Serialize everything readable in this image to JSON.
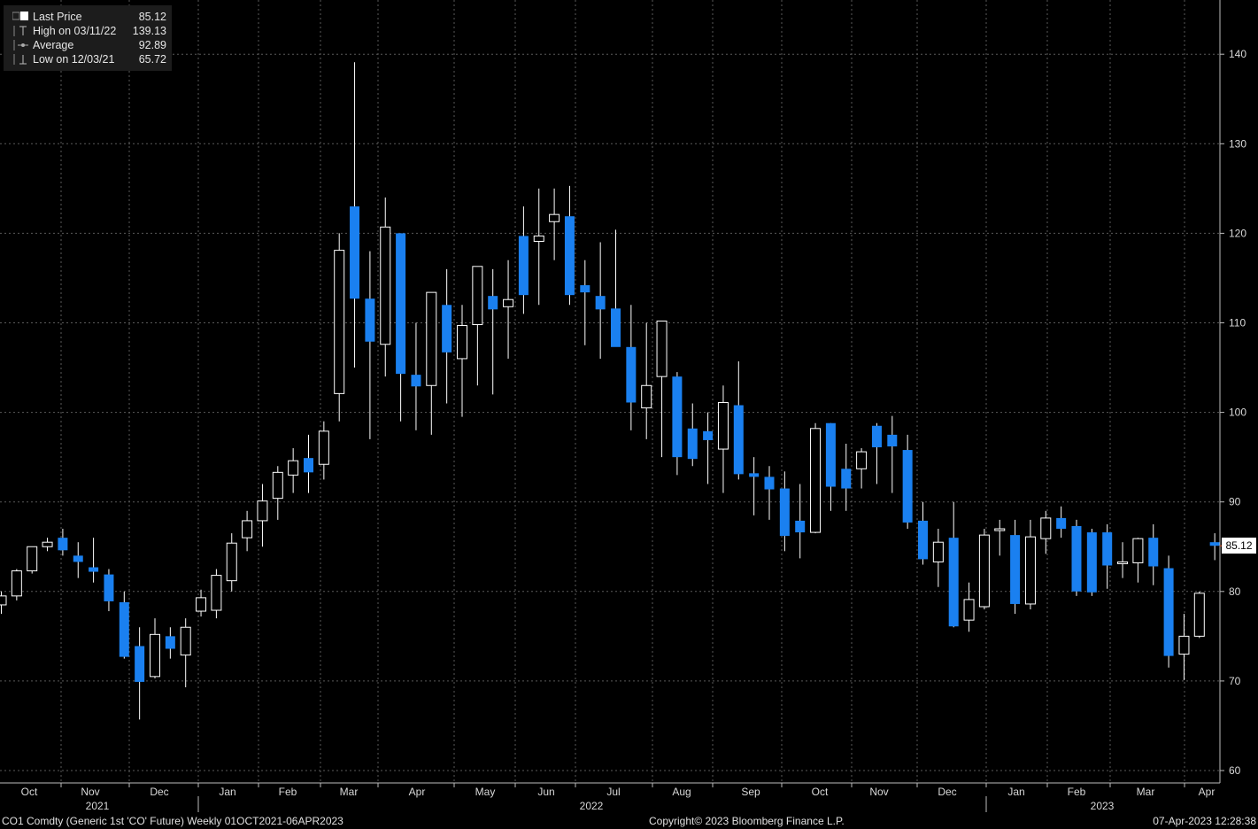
{
  "legend": {
    "items": [
      {
        "name": "Last Price",
        "value": "85.12",
        "icon": "square-icon"
      },
      {
        "name": "High on 03/11/22",
        "value": "139.13",
        "icon": "high-marker-icon"
      },
      {
        "name": "Average",
        "value": "92.89",
        "icon": "average-marker-icon"
      },
      {
        "name": "Low on 12/03/21",
        "value": "65.72",
        "icon": "low-marker-icon"
      }
    ]
  },
  "last_price_tag": "85.12",
  "footer": {
    "ticker": "CO1 Comdty (Generic 1st 'CO' Future)  Weekly 01OCT2021-06APR2023",
    "copyright": "Copyright© 2023 Bloomberg Finance L.P.",
    "timestamp": "07-Apr-2023 12:28:38"
  },
  "colors": {
    "background": "#000000",
    "down_candle": "#1a80f0",
    "up_candle_outline": "#ffffff",
    "grid": "#5a5a5a",
    "last_price_line": "#e04a1a"
  },
  "chart_data": {
    "type": "candlestick",
    "title": "",
    "xlabel": "",
    "ylabel": "",
    "ylim": [
      58,
      148
    ],
    "y_ticks": [
      60,
      70,
      80,
      90,
      100,
      110,
      120,
      130,
      140
    ],
    "grid": true,
    "axis_position": "right",
    "month_labels": [
      "Oct",
      "Nov",
      "Dec",
      "Jan",
      "Feb",
      "Mar",
      "Apr",
      "May",
      "Jun",
      "Jul",
      "Aug",
      "Sep",
      "Oct",
      "Nov",
      "Dec",
      "Jan",
      "Feb",
      "Mar",
      "Apr"
    ],
    "year_labels": [
      "2021",
      "2022",
      "2023"
    ],
    "series": [
      {
        "fields": [
          "open",
          "high",
          "low",
          "close"
        ],
        "candles": [
          [
            78.5,
            80,
            77.5,
            79.5
          ],
          [
            79.5,
            82.5,
            79,
            82.3
          ],
          [
            82.3,
            85,
            82,
            85
          ],
          [
            85,
            86,
            84.5,
            85.5
          ],
          [
            86,
            87,
            84,
            84.6
          ],
          [
            84,
            85.5,
            81.5,
            83.3
          ],
          [
            82.7,
            86,
            81,
            82.2
          ],
          [
            81.9,
            82.5,
            77.8,
            78.9
          ],
          [
            78.8,
            80,
            72.5,
            72.7
          ],
          [
            73.9,
            76,
            65.7,
            69.9
          ],
          [
            70.5,
            77,
            70.3,
            75.2
          ],
          [
            75,
            76,
            72.5,
            73.6
          ],
          [
            72.9,
            77,
            69.3,
            76
          ],
          [
            77.8,
            80.2,
            77.2,
            79.3
          ],
          [
            77.9,
            82.5,
            77,
            81.8
          ],
          [
            81.2,
            86.5,
            80,
            85.4
          ],
          [
            86,
            89,
            84.5,
            87.9
          ],
          [
            87.9,
            92,
            85,
            90.1
          ],
          [
            90.4,
            94,
            88,
            93.3
          ],
          [
            93,
            96,
            91,
            94.6
          ],
          [
            94.9,
            97.5,
            91,
            93.3
          ],
          [
            94.2,
            99,
            92.5,
            97.9
          ],
          [
            102.1,
            120,
            99,
            118.1
          ],
          [
            123,
            139.1,
            105,
            112.7
          ],
          [
            112.7,
            118,
            97,
            107.9
          ],
          [
            107.6,
            124,
            104,
            120.7
          ],
          [
            120,
            120,
            99,
            104.3
          ],
          [
            104.2,
            110,
            98,
            102.9
          ],
          [
            103,
            112,
            97.5,
            113.4
          ],
          [
            112,
            116,
            101,
            106.7
          ],
          [
            106,
            112,
            99.5,
            109.7
          ],
          [
            109.8,
            116,
            103,
            116.3
          ],
          [
            113,
            116,
            102,
            111.5
          ],
          [
            111.8,
            117,
            106,
            112.6
          ],
          [
            119.7,
            123,
            111,
            113.1
          ],
          [
            119.1,
            125,
            112,
            119.7
          ],
          [
            121.3,
            125,
            117,
            122.1
          ],
          [
            121.9,
            125.3,
            112,
            113.1
          ],
          [
            114.2,
            117,
            107.5,
            113.4
          ],
          [
            113,
            119,
            106,
            111.5
          ],
          [
            111.6,
            120.4,
            109,
            107.3
          ],
          [
            107.3,
            112,
            98,
            101.1
          ],
          [
            100.5,
            110,
            97,
            103
          ],
          [
            104,
            110,
            95,
            110.2
          ],
          [
            104,
            104.5,
            93,
            95
          ],
          [
            98.2,
            101,
            94,
            94.8
          ],
          [
            97.9,
            100,
            92,
            96.9
          ],
          [
            95.9,
            103,
            91,
            101.1
          ],
          [
            100.8,
            105.7,
            92.5,
            93.1
          ],
          [
            93.2,
            95,
            88.5,
            92.8
          ],
          [
            92.8,
            94,
            88,
            91.4
          ],
          [
            91.5,
            93.4,
            84.5,
            86.2
          ],
          [
            87.9,
            92,
            83.7,
            86.6
          ],
          [
            86.6,
            98.8,
            86.5,
            98.2
          ],
          [
            98.8,
            98.8,
            89,
            91.7
          ],
          [
            93.7,
            96.5,
            89,
            91.5
          ],
          [
            93.7,
            96,
            91.5,
            95.6
          ],
          [
            98.5,
            98.8,
            92,
            96.1
          ],
          [
            97.5,
            99.6,
            91,
            96.2
          ],
          [
            95.8,
            97.5,
            87,
            87.7
          ],
          [
            87.9,
            90,
            83,
            83.6
          ],
          [
            83.3,
            87,
            80.5,
            85.5
          ],
          [
            86,
            90,
            76,
            76.1
          ],
          [
            76.8,
            81,
            75.5,
            79.1
          ],
          [
            78.3,
            87,
            78,
            86.3
          ],
          [
            86.8,
            88,
            84,
            87
          ],
          [
            86.3,
            88,
            77.5,
            78.6
          ],
          [
            78.6,
            88,
            78,
            86.1
          ],
          [
            85.9,
            89,
            84.2,
            88.2
          ],
          [
            88.2,
            89.5,
            86,
            87
          ],
          [
            87.3,
            88,
            79.5,
            80
          ],
          [
            86.6,
            87,
            79.5,
            79.9
          ],
          [
            86.6,
            87.5,
            80.3,
            82.9
          ],
          [
            83.2,
            85.5,
            81.5,
            83.3
          ],
          [
            83.2,
            86,
            81,
            85.9
          ],
          [
            86,
            87.5,
            80.7,
            82.8
          ],
          [
            82.6,
            84,
            71.5,
            72.8
          ],
          [
            73,
            77.5,
            70.1,
            75
          ],
          [
            75,
            80,
            74.8,
            79.8
          ],
          [
            85.5,
            86.5,
            83.5,
            85.1
          ]
        ]
      }
    ]
  }
}
